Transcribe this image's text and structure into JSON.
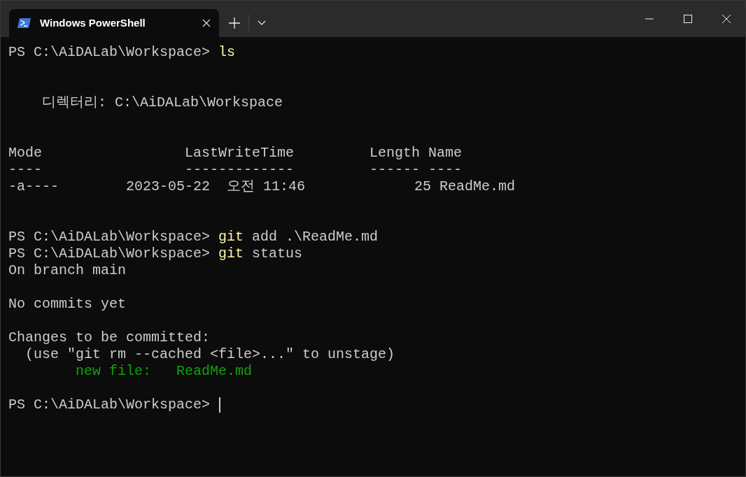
{
  "window": {
    "tab": {
      "title": "Windows PowerShell",
      "selected": true
    }
  },
  "terminal": {
    "lines": [
      {
        "kind": "text",
        "segments": [
          {
            "kind": "prompt",
            "text": "PS C:\\AiDALab\\Workspace> "
          },
          {
            "kind": "command",
            "text": "ls"
          }
        ]
      },
      {
        "kind": "blank"
      },
      {
        "kind": "blank"
      },
      {
        "kind": "text",
        "segments": [
          {
            "kind": "output",
            "text": "    디렉터리: C:\\AiDALab\\Workspace"
          }
        ]
      },
      {
        "kind": "blank"
      },
      {
        "kind": "blank"
      },
      {
        "kind": "text",
        "segments": [
          {
            "kind": "output",
            "text": "Mode                 LastWriteTime         Length Name"
          }
        ]
      },
      {
        "kind": "text",
        "segments": [
          {
            "kind": "output",
            "text": "----                 -------------         ------ ----"
          }
        ]
      },
      {
        "kind": "text",
        "segments": [
          {
            "kind": "output",
            "text": "-a----        2023-05-22  오전 11:46             25 ReadMe.md"
          }
        ]
      },
      {
        "kind": "blank"
      },
      {
        "kind": "blank"
      },
      {
        "kind": "text",
        "segments": [
          {
            "kind": "prompt",
            "text": "PS C:\\AiDALab\\Workspace> "
          },
          {
            "kind": "command",
            "text": "git"
          },
          {
            "kind": "argument",
            "text": " add .\\ReadMe.md"
          }
        ]
      },
      {
        "kind": "text",
        "segments": [
          {
            "kind": "prompt",
            "text": "PS C:\\AiDALab\\Workspace> "
          },
          {
            "kind": "command",
            "text": "git"
          },
          {
            "kind": "argument",
            "text": " status"
          }
        ]
      },
      {
        "kind": "text",
        "segments": [
          {
            "kind": "output",
            "text": "On branch main"
          }
        ]
      },
      {
        "kind": "blank"
      },
      {
        "kind": "text",
        "segments": [
          {
            "kind": "output",
            "text": "No commits yet"
          }
        ]
      },
      {
        "kind": "blank"
      },
      {
        "kind": "text",
        "segments": [
          {
            "kind": "output",
            "text": "Changes to be committed:"
          }
        ]
      },
      {
        "kind": "text",
        "segments": [
          {
            "kind": "output",
            "text": "  (use \"git rm --cached <file>...\" to unstage)"
          }
        ]
      },
      {
        "kind": "text",
        "segments": [
          {
            "kind": "staged",
            "text": "        new file:   ReadMe.md"
          }
        ]
      },
      {
        "kind": "blank"
      },
      {
        "kind": "text",
        "cursor": true,
        "segments": [
          {
            "kind": "prompt",
            "text": "PS C:\\AiDALab\\Workspace> "
          }
        ]
      }
    ]
  }
}
